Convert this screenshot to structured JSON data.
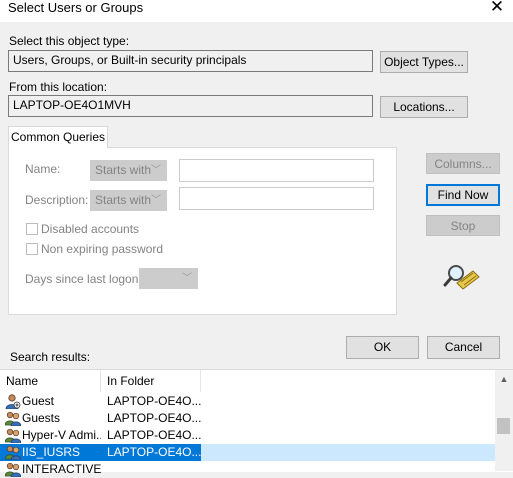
{
  "window": {
    "title": "Select Users or Groups"
  },
  "object_type": {
    "label": "Select this object type:",
    "value": "Users, Groups, or Built-in security principals",
    "button": "Object Types..."
  },
  "location": {
    "label": "From this location:",
    "value": "LAPTOP-OE4O1MVH",
    "button": "Locations..."
  },
  "common_queries": {
    "tab_label": "Common Queries",
    "name_label": "Name:",
    "name_match": "Starts with",
    "description_label": "Description:",
    "description_match": "Starts with",
    "disabled_accounts_label": "Disabled accounts",
    "non_expiring_label": "Non expiring password",
    "days_label": "Days since last logon:"
  },
  "side_buttons": {
    "columns": "Columns...",
    "find_now": "Find Now",
    "stop": "Stop"
  },
  "dialog_buttons": {
    "ok": "OK",
    "cancel": "Cancel"
  },
  "results": {
    "label": "Search results:",
    "columns": [
      "Name",
      "In Folder"
    ],
    "rows": [
      {
        "name": "Guest",
        "folder": "LAPTOP-OE4O...",
        "selected": false
      },
      {
        "name": "Guests",
        "folder": "LAPTOP-OE4O...",
        "selected": false
      },
      {
        "name": "Hyper-V Admi...",
        "folder": "LAPTOP-OE4O...",
        "selected": false
      },
      {
        "name": "IIS_IUSRS",
        "folder": "LAPTOP-OE4O...",
        "selected": true
      },
      {
        "name": "INTERACTIVE",
        "folder": "",
        "selected": false
      }
    ]
  },
  "colors": {
    "accent": "#0078d7",
    "selection_light": "#cce8ff",
    "disabled_text": "#838383"
  }
}
